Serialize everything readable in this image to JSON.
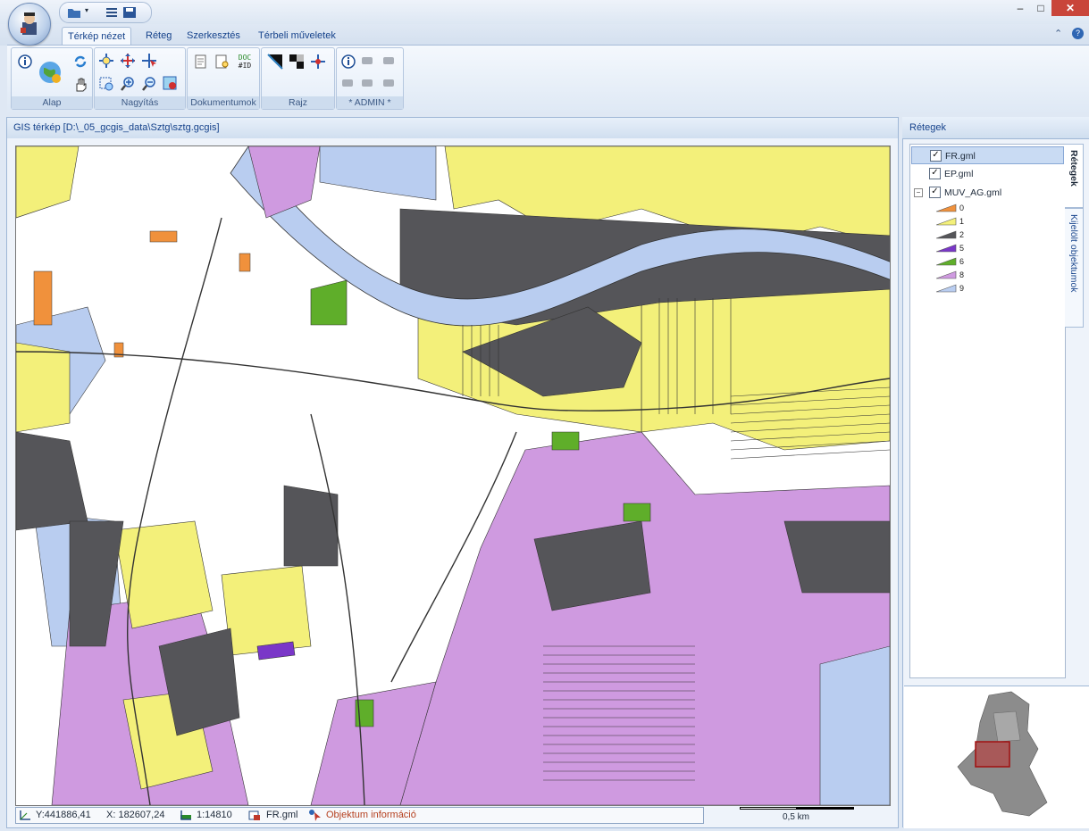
{
  "window": {
    "minimize": "–",
    "maximize": "□",
    "close": "✕"
  },
  "tabs": [
    {
      "label": "Térkép nézet",
      "active": true
    },
    {
      "label": "Réteg",
      "active": false
    },
    {
      "label": "Szerkesztés",
      "active": false
    },
    {
      "label": "Térbeli műveletek",
      "active": false
    }
  ],
  "ribbon": {
    "groups": {
      "alap": "Alap",
      "nagyitas": "Nagyítás",
      "dokumentumok": "Dokumentumok",
      "rajz": "Rajz",
      "admin": "* ADMIN *"
    },
    "doc_icon_text_top": "DOC",
    "doc_icon_text_bottom": "#ID"
  },
  "map_panel": {
    "title": "GIS térkép [D:\\_05_gcgis_data\\Sztg\\sztg.gcgis]"
  },
  "status": {
    "y": "Y:441886,41",
    "x": "X: 182607,24",
    "scale": "1:14810",
    "layer": "FR.gml",
    "info": "Objektum információ"
  },
  "scalebar_label": "0,5 km",
  "right_panel": {
    "title": "Rétegek",
    "vtab_layers": "Rétegek",
    "vtab_selected": "Kijelölt objektumok",
    "layers": [
      {
        "name": "FR.gml",
        "checked": true,
        "selected": true
      },
      {
        "name": "EP.gml",
        "checked": true,
        "selected": false
      },
      {
        "name": "MUV_AG.gml",
        "checked": true,
        "selected": false
      }
    ],
    "legend": [
      {
        "label": "0",
        "color": "#f0913c"
      },
      {
        "label": "1",
        "color": "#f3f07a"
      },
      {
        "label": "2",
        "color": "#555559"
      },
      {
        "label": "5",
        "color": "#7a37c8"
      },
      {
        "label": "6",
        "color": "#5fae2a"
      },
      {
        "label": "8",
        "color": "#cf9ae0"
      },
      {
        "label": "9",
        "color": "#b9cdf0"
      }
    ]
  },
  "colors": {
    "accent": "#15428b",
    "map_white": "#ffffff",
    "map_yellow": "#f3f07a",
    "map_gray": "#555559",
    "map_purple": "#cf9ae0",
    "map_blue": "#b9cdf0",
    "map_green": "#5fae2a",
    "map_orange": "#f0913c",
    "overview_highlight": "#c03030"
  }
}
